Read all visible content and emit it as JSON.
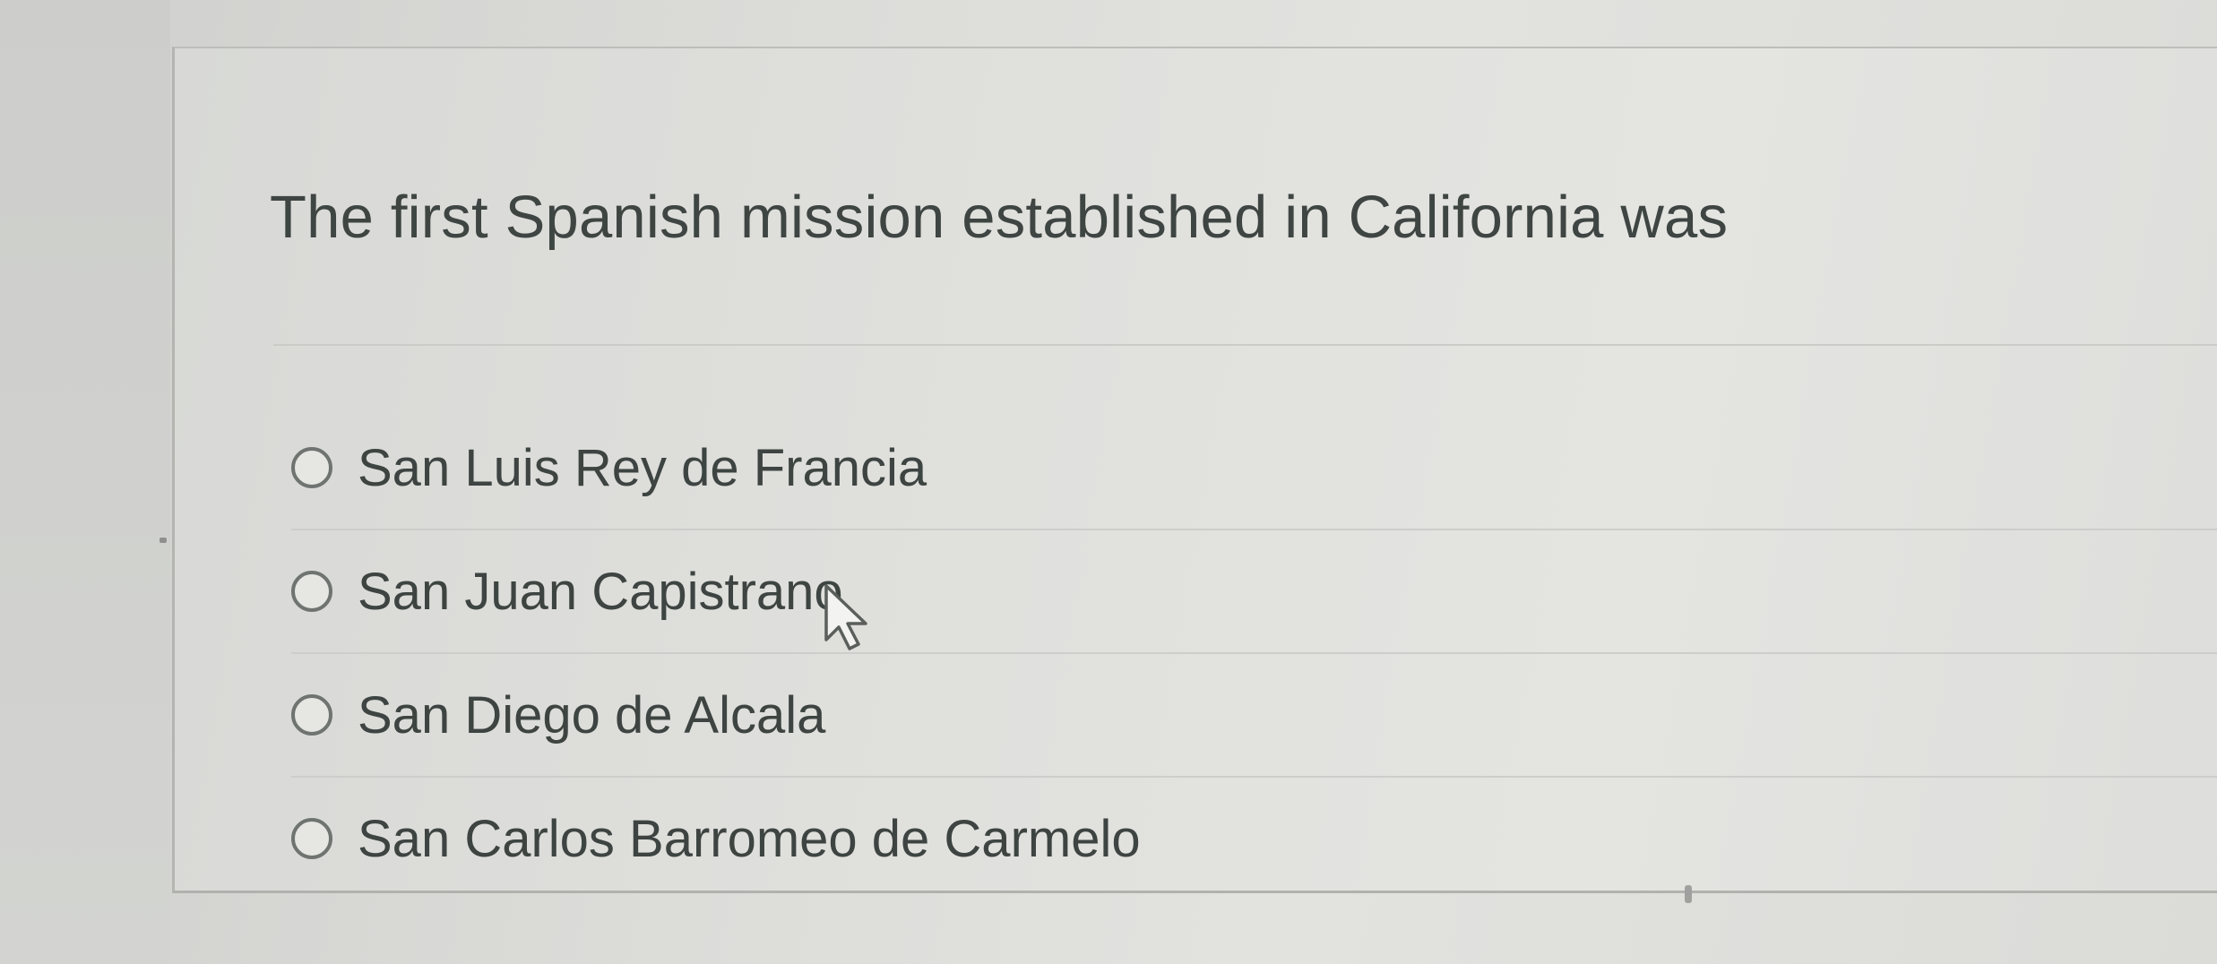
{
  "question": {
    "text": "The first Spanish mission established in California was"
  },
  "answers": [
    {
      "label": "San Luis Rey de Francia",
      "selected": false
    },
    {
      "label": "San Juan Capistrano",
      "selected": false
    },
    {
      "label": "San Diego de Alcala",
      "selected": false
    },
    {
      "label": "San Carlos Barromeo de Carmelo",
      "selected": false
    }
  ],
  "icons": {
    "radio": "radio-button-icon",
    "cursor": "mouse-pointer-icon"
  },
  "colors": {
    "text": "#3e4542",
    "radio_border": "#6f7471",
    "background": "#e0e0dd"
  }
}
